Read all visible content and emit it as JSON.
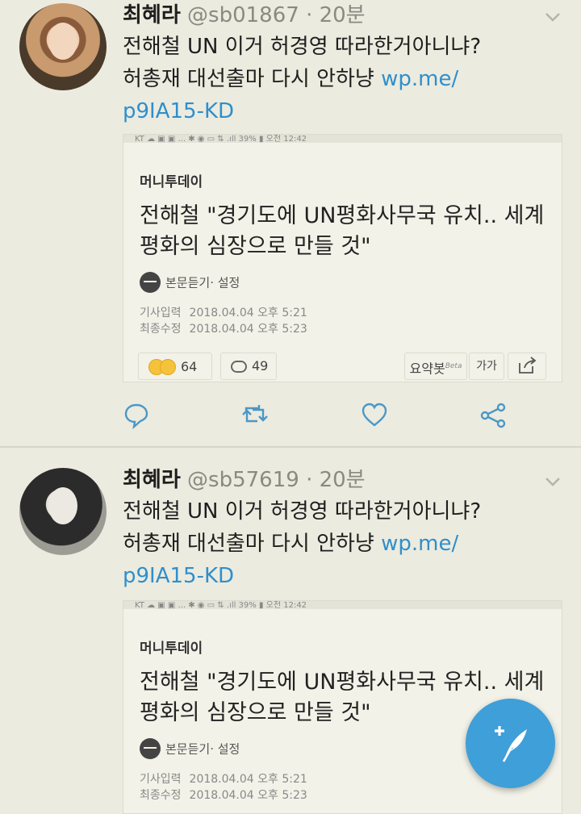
{
  "tweets": [
    {
      "display_name": "최혜라",
      "handle": "@sb01867",
      "separator": "·",
      "time": "20분",
      "text_line1": "전해철 UN 이거 허경영 따라한거아니냐?",
      "text_line2_plain": "허총재 대선출마 다시 안하냥 ",
      "link_part1": "wp.me/",
      "link_part2": "p9IA15-KD",
      "card": {
        "statusbar": "KT  ☁  ▣ ▣ ...            ✱ ◉ ▭  ⇅ .ıll 39% ▮ 오전 12:42",
        "publisher": "머니투데이",
        "headline": "전해철 \"경기도에 UN평화사무국 유치.. 세계 평화의 심장으로 만들 것\"",
        "listen_label": "본문듣기",
        "settings_label": "· 설정",
        "input_label": "기사입력",
        "input_value": "2018.04.04 오후 5:21",
        "modified_label": "최종수정",
        "modified_value": "2018.04.04 오후 5:23",
        "reactions_count": "64",
        "comments_count": "49",
        "summary_label": "요약봇",
        "summary_sup": "Beta",
        "font_label": "가가"
      }
    },
    {
      "display_name": "최혜라",
      "handle": "@sb57619",
      "separator": "·",
      "time": "20분",
      "text_line1": "전해철 UN 이거 허경영 따라한거아니냐?",
      "text_line2_plain": "허총재 대선출마 다시 안하냥 ",
      "link_part1": "wp.me/",
      "link_part2": "p9IA15-KD",
      "card": {
        "statusbar": "KT  ☁  ▣ ▣ ...            ✱ ◉ ▭  ⇅ .ıll 39% ▮ 오전 12:42",
        "publisher": "머니투데이",
        "headline": "전해철 \"경기도에 UN평화사무국 유치.. 세계 평화의 심장으로 만들 것\"",
        "listen_label": "본문듣기",
        "settings_label": "· 설정",
        "input_label": "기사입력",
        "input_value": "2018.04.04 오후 5:21",
        "modified_label": "최종수정",
        "modified_value": "2018.04.04 오후 5:23"
      }
    }
  ],
  "colors": {
    "background": "#ecebdf",
    "link": "#2f8fcc",
    "fab": "#3f9fd8",
    "muted": "#8a8a83"
  },
  "icons": {
    "chevron": "chevron-down-icon",
    "reply": "reply-icon",
    "retweet": "retweet-icon",
    "like": "heart-icon",
    "share": "share-icon",
    "compose": "compose-feather-icon"
  }
}
